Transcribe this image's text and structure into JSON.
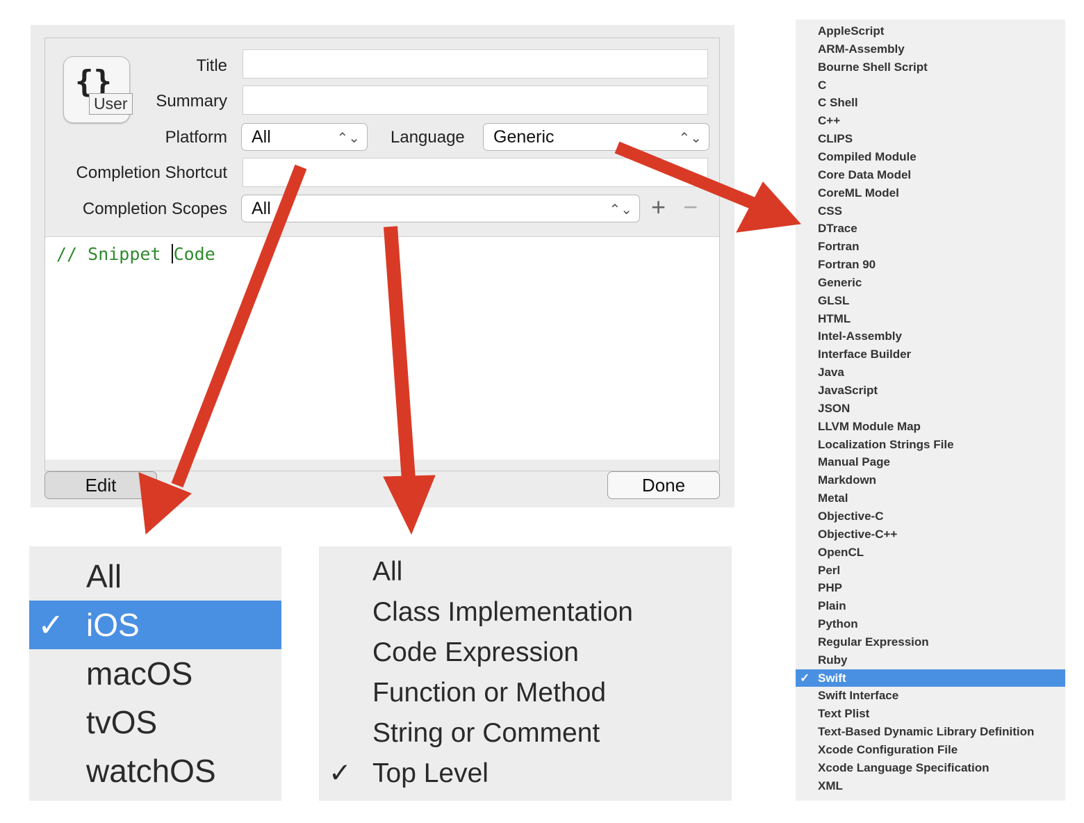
{
  "editor": {
    "icon_braces": "{}",
    "icon_badge": "User",
    "labels": {
      "title": "Title",
      "summary": "Summary",
      "platform": "Platform",
      "language": "Language",
      "completion_shortcut": "Completion Shortcut",
      "completion_scopes": "Completion Scopes"
    },
    "fields": {
      "title": "",
      "summary": "",
      "completion_shortcut": ""
    },
    "platform_value": "All",
    "language_value": "Generic",
    "scopes_value": "All",
    "add_symbol": "+",
    "remove_symbol": "−",
    "updown_symbol": "⌃⌄",
    "code_before_caret": "// Snippet ",
    "code_after_caret": "Code",
    "edit_button": "Edit",
    "done_button": "Done"
  },
  "platform_menu": {
    "items": [
      {
        "label": "All",
        "check": ""
      },
      {
        "label": "iOS",
        "check": "✓"
      },
      {
        "label": "macOS",
        "check": ""
      },
      {
        "label": "tvOS",
        "check": ""
      },
      {
        "label": "watchOS",
        "check": ""
      }
    ]
  },
  "scope_menu": {
    "items": [
      {
        "label": "All",
        "check": ""
      },
      {
        "label": "Class Implementation",
        "check": ""
      },
      {
        "label": "Code Expression",
        "check": ""
      },
      {
        "label": "Function or Method",
        "check": ""
      },
      {
        "label": "String or Comment",
        "check": ""
      },
      {
        "label": "Top Level",
        "check": "✓"
      }
    ]
  },
  "language_menu": {
    "selected": "Swift",
    "check": "✓",
    "items": [
      "AppleScript",
      "ARM-Assembly",
      "Bourne Shell Script",
      "C",
      "C Shell",
      "C++",
      "CLIPS",
      "Compiled Module",
      "Core Data Model",
      "CoreML Model",
      "CSS",
      "DTrace",
      "Fortran",
      "Fortran 90",
      "Generic",
      "GLSL",
      "HTML",
      "Intel-Assembly",
      "Interface Builder",
      "Java",
      "JavaScript",
      "JSON",
      "LLVM Module Map",
      "Localization Strings File",
      "Manual Page",
      "Markdown",
      "Metal",
      "Objective-C",
      "Objective-C++",
      "OpenCL",
      "Perl",
      "PHP",
      "Plain",
      "Python",
      "Regular Expression",
      "Ruby",
      "Swift",
      "Swift Interface",
      "Text Plist",
      "Text-Based Dynamic Library Definition",
      "Xcode Configuration File",
      "Xcode Language Specification",
      "XML"
    ]
  },
  "colors": {
    "arrow": "#d93a26",
    "selection": "#4a90e2",
    "code_comment": "#2e8b2e"
  }
}
